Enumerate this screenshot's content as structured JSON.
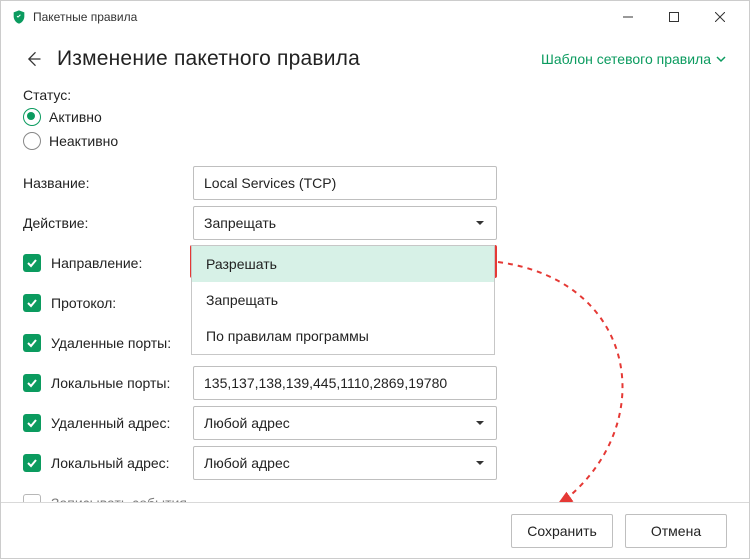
{
  "window": {
    "title": "Пакетные правила"
  },
  "header": {
    "title": "Изменение пакетного правила",
    "template_link": "Шаблон сетевого правила"
  },
  "labels": {
    "status": "Статус:",
    "status_active": "Активно",
    "status_inactive": "Неактивно",
    "name": "Название:",
    "action": "Действие:",
    "direction": "Направление:",
    "protocol": "Протокол:",
    "remote_ports": "Удаленные порты:",
    "local_ports": "Локальные порты:",
    "remote_addr": "Удаленный адрес:",
    "local_addr": "Локальный адрес:",
    "log_events": "Записывать события"
  },
  "values": {
    "name": "Local Services (TCP)",
    "action_selected": "Запрещать",
    "local_ports": "135,137,138,139,445,1110,2869,19780",
    "remote_addr": "Любой адрес",
    "local_addr": "Любой адрес"
  },
  "dropdown_options": {
    "action": [
      "Разрешать",
      "Запрещать",
      "По правилам программы"
    ]
  },
  "footer": {
    "save": "Сохранить",
    "cancel": "Отмена"
  }
}
